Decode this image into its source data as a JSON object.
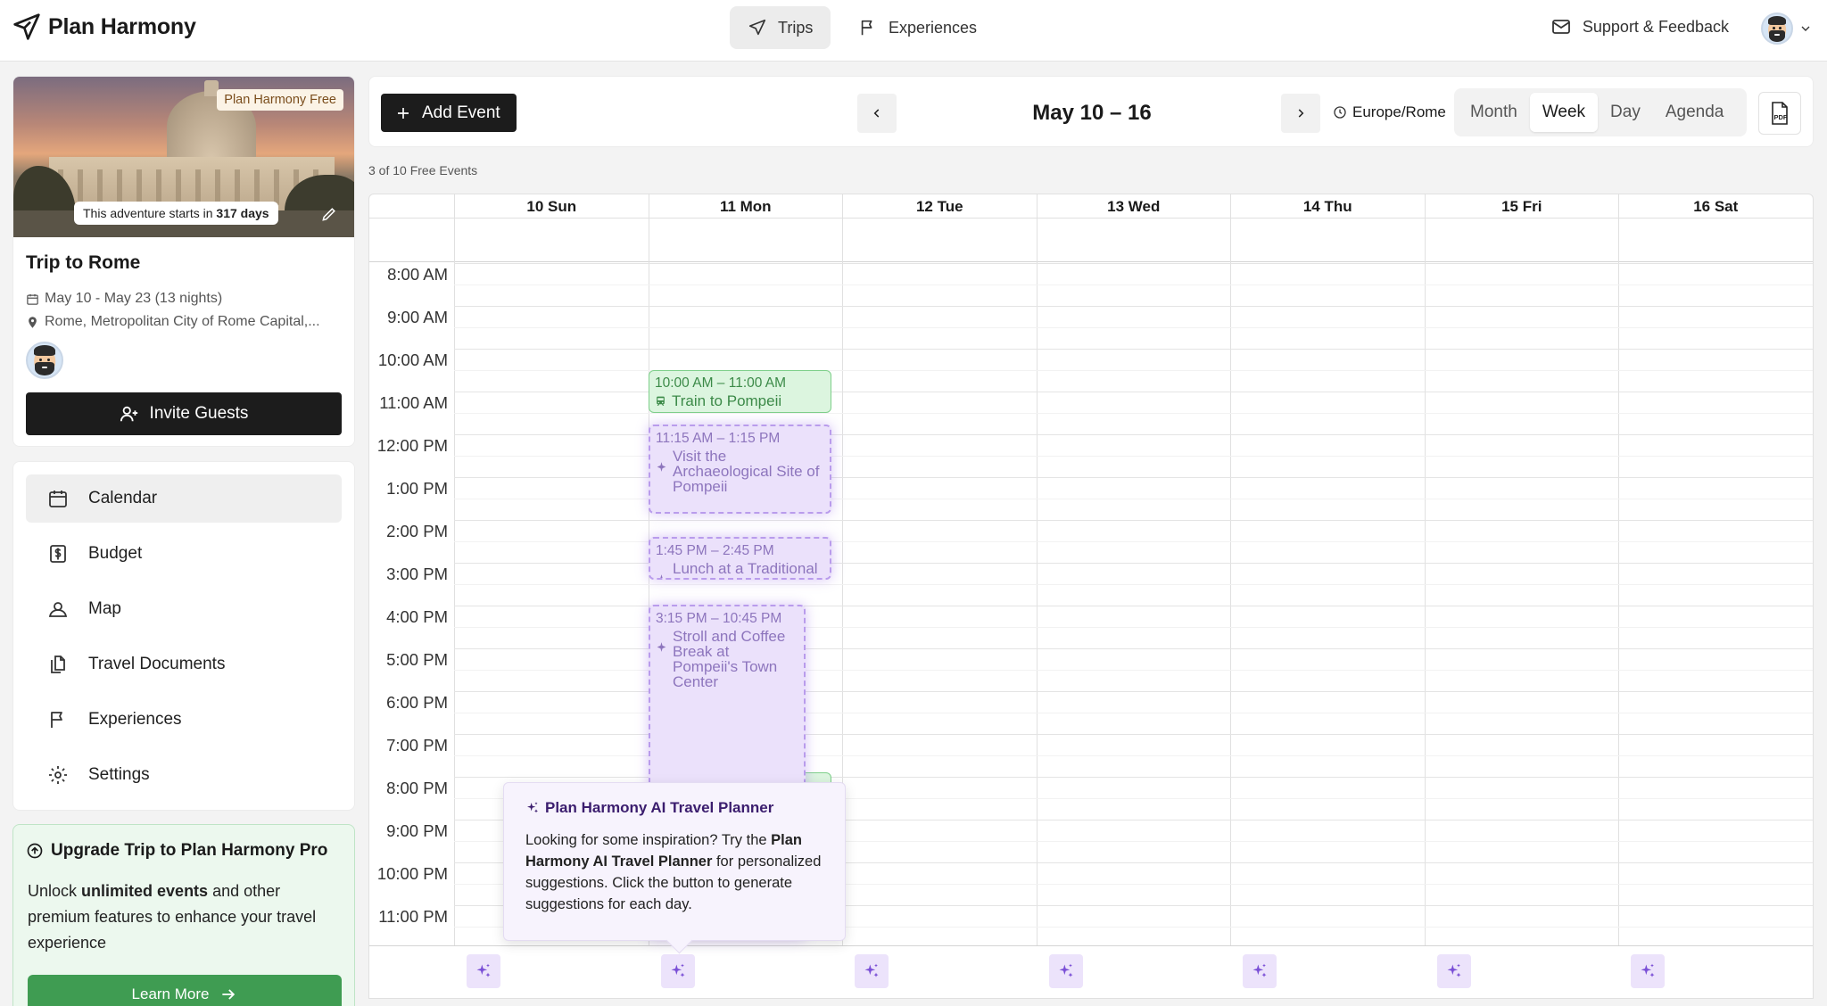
{
  "app": {
    "name": "Plan Harmony"
  },
  "topnav": {
    "tabs": [
      {
        "label": "Trips"
      },
      {
        "label": "Experiences"
      }
    ],
    "support_label": "Support & Feedback"
  },
  "trip": {
    "badge": "Plan Harmony Free",
    "countdown_prefix": "This adventure starts in",
    "countdown_value": "317 days",
    "title": "Trip to Rome",
    "dates": "May 10 - May 23 (13 nights)",
    "location": "Rome, Metropolitan City of Rome Capital,...",
    "invite_label": "Invite Guests"
  },
  "sidebar": {
    "items": [
      {
        "label": "Calendar",
        "icon": "calendar-icon"
      },
      {
        "label": "Budget",
        "icon": "budget-icon"
      },
      {
        "label": "Map",
        "icon": "map-pin-icon"
      },
      {
        "label": "Travel Documents",
        "icon": "documents-icon"
      },
      {
        "label": "Experiences",
        "icon": "flag-icon"
      },
      {
        "label": "Settings",
        "icon": "gear-icon"
      }
    ]
  },
  "upgrade": {
    "title": "Upgrade Trip to Plan Harmony Pro",
    "desc_prefix": "Unlock ",
    "desc_bold": "unlimited events",
    "desc_suffix": " and other premium features to enhance your travel experience",
    "button": "Learn More"
  },
  "toolbar": {
    "add_event": "Add Event",
    "range": "May 10 – 16",
    "timezone": "Europe/Rome",
    "views": [
      "Month",
      "Week",
      "Day",
      "Agenda"
    ],
    "active_view": "Week",
    "pdf_label": "PDF",
    "free_events": "3 of 10 Free Events"
  },
  "calendar": {
    "days": [
      "10 Sun",
      "11 Mon",
      "12 Tue",
      "13 Wed",
      "14 Thu",
      "15 Fri",
      "16 Sat"
    ],
    "hours": [
      "8:00 AM",
      "9:00 AM",
      "10:00 AM",
      "11:00 AM",
      "12:00 PM",
      "1:00 PM",
      "2:00 PM",
      "3:00 PM",
      "4:00 PM",
      "5:00 PM",
      "6:00 PM",
      "7:00 PM",
      "8:00 PM",
      "9:00 PM",
      "10:00 PM",
      "11:00 PM"
    ],
    "events": [
      {
        "time": "10:00 AM – 11:00 AM",
        "title": "Train to Pompeii",
        "kind": "train"
      },
      {
        "time": "11:15 AM – 1:15 PM",
        "title": "Visit the Archaeological Site of Pompeii",
        "kind": "ai"
      },
      {
        "time": "1:45 PM – 2:45 PM",
        "title": "Lunch at a Traditional Italian Osteria",
        "kind": "ai"
      },
      {
        "time": "3:15 PM – 10:45 PM",
        "title": "Stroll and Coffee Break at Pompeii's Town Center",
        "kind": "ai"
      }
    ]
  },
  "tooltip": {
    "title": "Plan Harmony AI Travel Planner",
    "body_prefix": "Looking for some inspiration? Try the ",
    "body_bold": "Plan Harmony AI Travel Planner",
    "body_suffix": " for personalized suggestions. Click the button to generate suggestions for each day."
  }
}
